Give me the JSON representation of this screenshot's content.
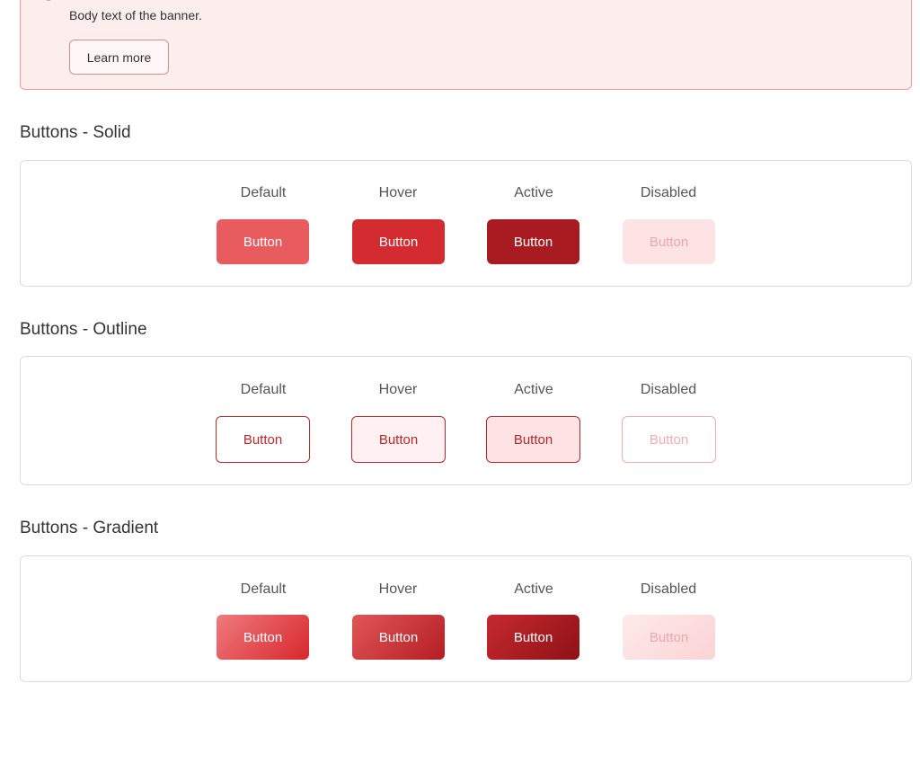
{
  "banner": {
    "body": "Body text of the banner.",
    "learn_more": "Learn more"
  },
  "sections": [
    {
      "title": "Buttons - Solid",
      "states": [
        "Default",
        "Hover",
        "Active",
        "Disabled"
      ],
      "buttons": [
        "Button",
        "Button",
        "Button",
        "Button"
      ]
    },
    {
      "title": "Buttons - Outline",
      "states": [
        "Default",
        "Hover",
        "Active",
        "Disabled"
      ],
      "buttons": [
        "Button",
        "Button",
        "Button",
        "Button"
      ]
    },
    {
      "title": "Buttons - Gradient",
      "states": [
        "Default",
        "Hover",
        "Active",
        "Disabled"
      ],
      "buttons": [
        "Button",
        "Button",
        "Button",
        "Button"
      ]
    }
  ],
  "colors": {
    "banner_bg": "#fdeeee",
    "banner_border": "#ef9a9a",
    "solid_default": "#e85c60",
    "solid_hover": "#d32b2f",
    "solid_active": "#a81b20",
    "solid_disabled": "#fde3e4",
    "outline_border": "#b5292e"
  }
}
